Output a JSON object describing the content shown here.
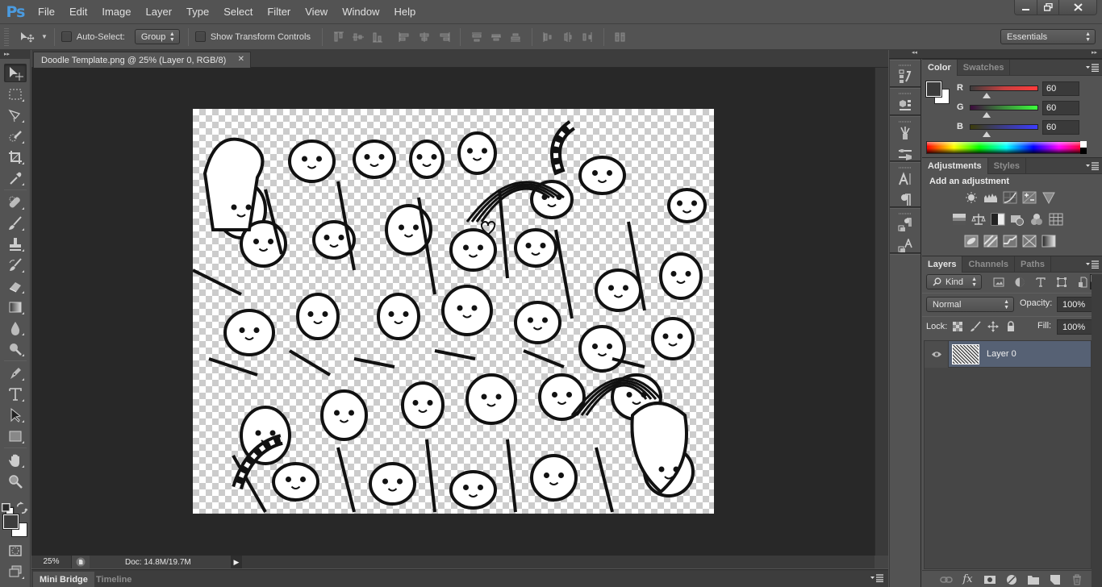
{
  "app": {
    "logo": "Ps",
    "menu": [
      "File",
      "Edit",
      "Image",
      "Layer",
      "Type",
      "Select",
      "Filter",
      "View",
      "Window",
      "Help"
    ],
    "window_controls": [
      "minimize",
      "restore",
      "close"
    ]
  },
  "options_bar": {
    "auto_select_label": "Auto-Select:",
    "auto_select_checked": false,
    "auto_select_target": "Group",
    "show_transform_label": "Show Transform Controls",
    "show_transform_checked": false,
    "align_icons": [
      "align-top-edges-icon",
      "align-vertical-centers-icon",
      "align-bottom-edges-icon",
      "align-left-edges-icon",
      "align-horizontal-centers-icon",
      "align-right-edges-icon",
      "distribute-top-edges-icon",
      "distribute-vertical-centers-icon",
      "distribute-bottom-edges-icon",
      "distribute-left-edges-icon",
      "distribute-horizontal-centers-icon",
      "distribute-right-edges-icon",
      "auto-align-layers-icon"
    ],
    "workspace": "Essentials"
  },
  "document": {
    "tab_title": "Doodle Template.png @ 25% (Layer 0, RGB/8)",
    "zoom": "25%",
    "doc_info": "Doc: 14.8M/19.7M"
  },
  "tools": [
    {
      "name": "move-tool",
      "active": true
    },
    {
      "name": "rectangular-marquee-tool"
    },
    {
      "name": "polygonal-lasso-tool"
    },
    {
      "name": "quick-selection-tool"
    },
    {
      "name": "crop-tool"
    },
    {
      "name": "eyedropper-tool"
    },
    {
      "name": "spot-healing-brush-tool"
    },
    {
      "name": "brush-tool"
    },
    {
      "name": "clone-stamp-tool"
    },
    {
      "name": "history-brush-tool"
    },
    {
      "name": "eraser-tool"
    },
    {
      "name": "gradient-tool"
    },
    {
      "name": "blur-tool"
    },
    {
      "name": "dodge-tool"
    },
    {
      "name": "pen-tool"
    },
    {
      "name": "horizontal-type-tool"
    },
    {
      "name": "path-selection-tool"
    },
    {
      "name": "rectangle-tool"
    },
    {
      "name": "hand-tool"
    },
    {
      "name": "zoom-tool"
    }
  ],
  "colors": {
    "foreground": "#3c3c3c",
    "background": "#ffffff",
    "accent_layer_selected": "#566174"
  },
  "bottom_panel": {
    "tabs": [
      "Mini Bridge",
      "Timeline"
    ],
    "active_tab": "Mini Bridge"
  },
  "color_panel": {
    "tabs": [
      "Color",
      "Swatches"
    ],
    "active_tab": "Color",
    "channels": [
      {
        "label": "R",
        "value": "60",
        "fraction": 0.235
      },
      {
        "label": "G",
        "value": "60",
        "fraction": 0.235
      },
      {
        "label": "B",
        "value": "60",
        "fraction": 0.235
      }
    ]
  },
  "adjustments_panel": {
    "tabs": [
      "Adjustments",
      "Styles"
    ],
    "active_tab": "Adjustments",
    "title": "Add an adjustment",
    "rows": [
      [
        "brightness-contrast-icon",
        "levels-icon",
        "curves-icon",
        "exposure-icon",
        "vibrance-icon"
      ],
      [
        "hue-saturation-icon",
        "color-balance-icon",
        "black-white-icon",
        "photo-filter-icon",
        "channel-mixer-icon",
        "color-lookup-icon"
      ],
      [
        "invert-icon",
        "posterize-icon",
        "threshold-icon",
        "selective-color-icon",
        "gradient-map-icon"
      ]
    ]
  },
  "layers_panel": {
    "tabs": [
      "Layers",
      "Channels",
      "Paths"
    ],
    "active_tab": "Layers",
    "filter_kind": "Kind",
    "blend_mode": "Normal",
    "opacity_label": "Opacity:",
    "opacity": "100%",
    "lock_label": "Lock:",
    "fill_label": "Fill:",
    "fill": "100%",
    "layers": [
      {
        "name": "Layer 0",
        "visible": true,
        "selected": true
      }
    ]
  }
}
